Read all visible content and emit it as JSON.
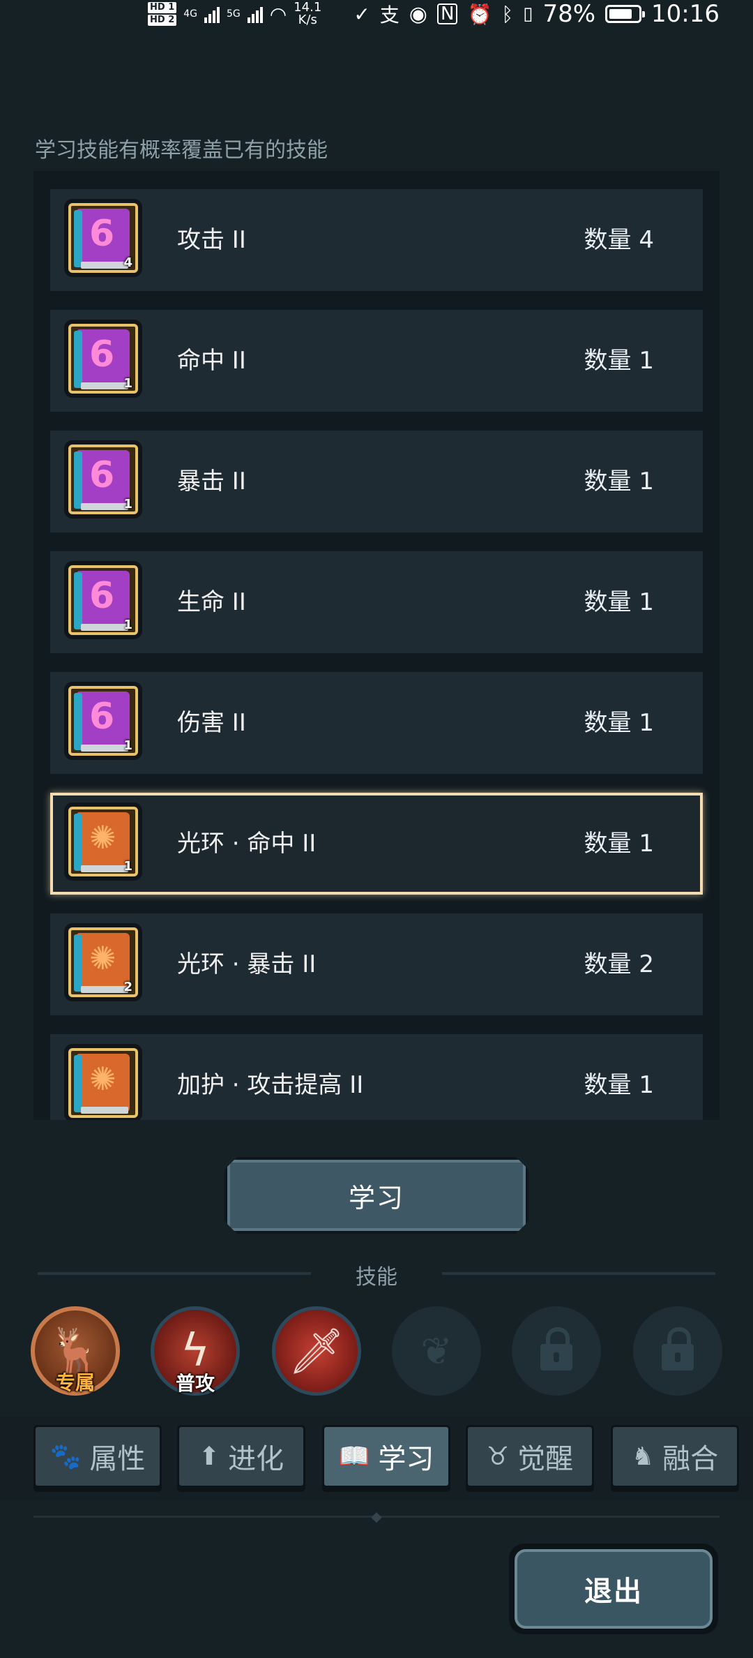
{
  "status_bar": {
    "hd1": "HD 1",
    "hd2": "HD 2",
    "network_type_1": "4G",
    "network_type_2": "5G",
    "net_speed_value": "14.1",
    "net_speed_unit": "K/s",
    "battery": "78%",
    "time": "10:16",
    "icons": [
      "hd-icon",
      "signal-icon",
      "wifi-icon",
      "payment-icon",
      "alipay-icon",
      "eye-icon",
      "nfc-icon",
      "alarm-icon",
      "bluetooth-icon",
      "vibrate-icon",
      "battery-icon"
    ]
  },
  "hint": "学习技能有概率覆盖已有的技能",
  "skill_books": [
    {
      "name": "攻击 II",
      "quantity": "数量 4",
      "count_badge": "4",
      "icon": "purple-book-icon",
      "selected": false
    },
    {
      "name": "命中 II",
      "quantity": "数量 1",
      "count_badge": "1",
      "icon": "purple-book-icon",
      "selected": false
    },
    {
      "name": "暴击 II",
      "quantity": "数量 1",
      "count_badge": "1",
      "icon": "purple-book-icon",
      "selected": false
    },
    {
      "name": "生命 II",
      "quantity": "数量 1",
      "count_badge": "1",
      "icon": "purple-book-icon",
      "selected": false
    },
    {
      "name": "伤害 II",
      "quantity": "数量 1",
      "count_badge": "1",
      "icon": "purple-book-icon",
      "selected": false
    },
    {
      "name": "光环 · 命中 II",
      "quantity": "数量 1",
      "count_badge": "1",
      "icon": "orange-book-icon",
      "selected": true
    },
    {
      "name": "光环 · 暴击 II",
      "quantity": "数量 2",
      "count_badge": "2",
      "icon": "orange-book-icon",
      "selected": false
    },
    {
      "name": "加护 · 攻击提高 II",
      "quantity": "数量 1",
      "count_badge": "",
      "icon": "orange-book-icon",
      "selected": false
    }
  ],
  "learn_button": "学习",
  "skills_section": {
    "title": "技能",
    "slots": [
      {
        "label": "专属",
        "icon": "exclusive-beast-icon",
        "locked": false
      },
      {
        "label": "普攻",
        "icon": "normal-attack-icon",
        "locked": false
      },
      {
        "label": "",
        "icon": "sword-icon",
        "locked": false
      },
      {
        "label": "",
        "icon": "empty-skill-icon",
        "locked": false
      },
      {
        "label": "",
        "icon": "lock-icon",
        "locked": true
      },
      {
        "label": "",
        "icon": "lock-icon",
        "locked": true
      }
    ]
  },
  "tabs": [
    {
      "label": "属性",
      "icon": "paw-icon",
      "active": false
    },
    {
      "label": "进化",
      "icon": "arrow-up-icon",
      "active": false
    },
    {
      "label": "学习",
      "icon": "book-icon",
      "active": true
    },
    {
      "label": "觉醒",
      "icon": "beast-head-icon",
      "active": false
    },
    {
      "label": "融合",
      "icon": "fusion-icon",
      "active": false
    }
  ],
  "exit_button": "退出",
  "colors": {
    "background": "#162126",
    "row_bg": "#1f2b32",
    "selected_border": "#f4dcb0",
    "active_tab": "#4a6470",
    "button": "#3f5866"
  }
}
